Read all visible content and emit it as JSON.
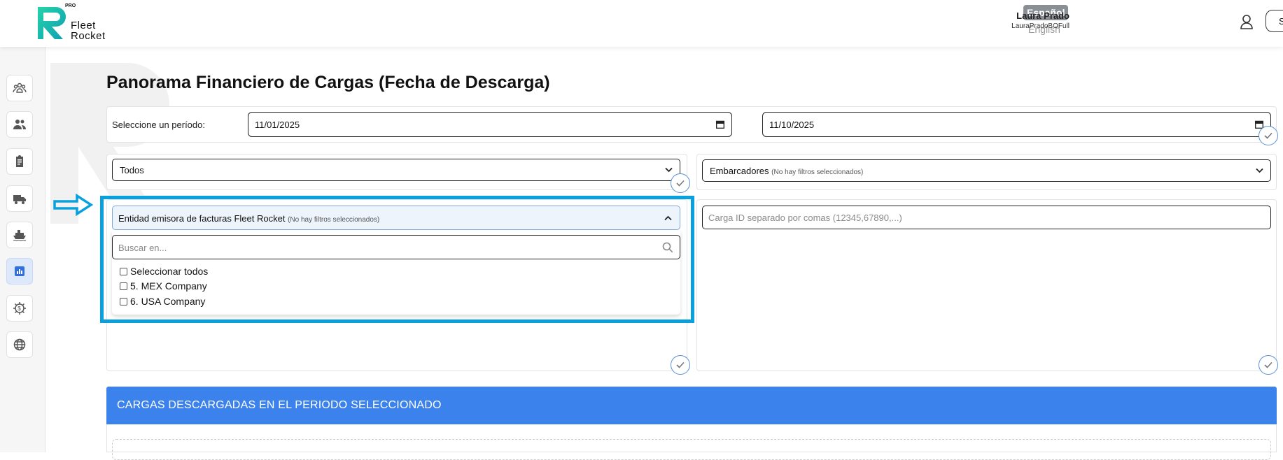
{
  "header": {
    "logo_badge": "PRO",
    "logo_line1": "Fleet",
    "logo_line2": "Rocket",
    "lang_active": "Español",
    "lang_other": "English",
    "user_name": "Laura Prado",
    "user_login": "LauraPradoBOFull",
    "partial_button": "S"
  },
  "sidebar": {
    "items": [
      {
        "icon": "team-icon"
      },
      {
        "icon": "users-icon"
      },
      {
        "icon": "clipboard-icon"
      },
      {
        "icon": "truck-icon"
      },
      {
        "icon": "ship-icon"
      },
      {
        "icon": "chart-icon",
        "active": true
      },
      {
        "icon": "finance-gear-icon"
      },
      {
        "icon": "globe-icon"
      }
    ]
  },
  "page": {
    "title": "Panorama Financiero de Cargas (Fecha de Descarga)"
  },
  "period": {
    "label": "Seleccione un período:",
    "start": "11/01/2025",
    "end": "11/10/2025"
  },
  "filters": {
    "status_value": "Todos",
    "shippers_label": "Embarcadores",
    "shippers_hint": "(No hay filtros seleccionados)",
    "issuer_label": "Entidad emisora de facturas Fleet Rocket",
    "issuer_hint": "(No hay filtros seleccionados)",
    "search_placeholder": "Buscar en...",
    "options": [
      "Seleccionar todos",
      "5. MEX Company",
      "6. USA Company"
    ],
    "load_id_placeholder": "Carga ID separado por comas (12345,67890,...)"
  },
  "section": {
    "banner_title": "CARGAS DESCARGADAS EN EL PERIODO SELECCIONADO"
  },
  "colors": {
    "accent": "#3b82ed",
    "highlight": "#0aa0de",
    "logo_teal": "#1fcfb0"
  }
}
